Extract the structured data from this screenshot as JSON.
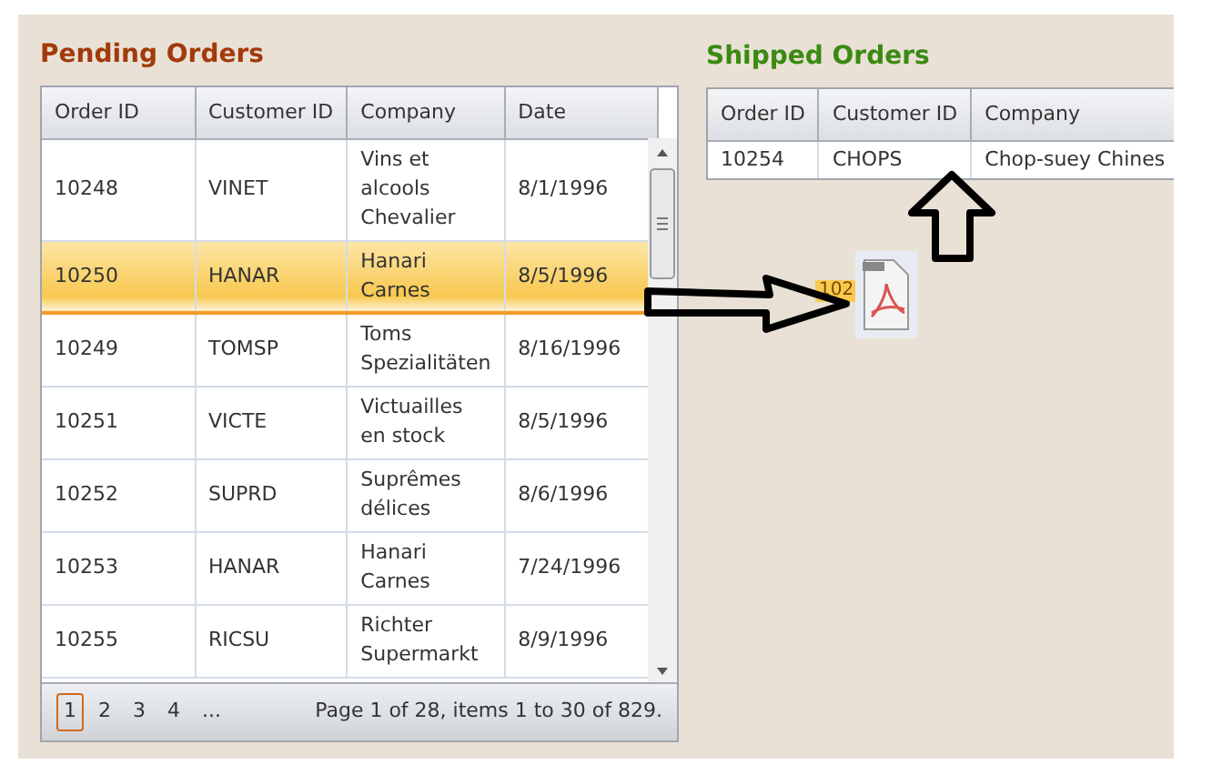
{
  "pending": {
    "title": "Pending Orders",
    "columns": [
      "Order ID",
      "Customer ID",
      "Company",
      "Date"
    ],
    "rows": [
      {
        "order_id": "10248",
        "customer_id": "VINET",
        "company": "Vins et alcools Chevalier",
        "date": "8/1/1996",
        "selected": false
      },
      {
        "order_id": "10250",
        "customer_id": "HANAR",
        "company": "Hanari Carnes",
        "date": "8/5/1996",
        "selected": true
      },
      {
        "order_id": "10249",
        "customer_id": "TOMSP",
        "company": "Toms Spezialitäten",
        "date": "8/16/1996",
        "selected": false
      },
      {
        "order_id": "10251",
        "customer_id": "VICTE",
        "company": "Victuailles en stock",
        "date": "8/5/1996",
        "selected": false
      },
      {
        "order_id": "10252",
        "customer_id": "SUPRD",
        "company": "Suprêmes délices",
        "date": "8/6/1996",
        "selected": false
      },
      {
        "order_id": "10253",
        "customer_id": "HANAR",
        "company": "Hanari Carnes",
        "date": "7/24/1996",
        "selected": false
      },
      {
        "order_id": "10255",
        "customer_id": "RICSU",
        "company": "Richter Supermarkt",
        "date": "8/9/1996",
        "selected": false
      }
    ],
    "pager": {
      "pages": [
        {
          "label": "1",
          "selected": true
        },
        {
          "label": "2",
          "selected": false
        },
        {
          "label": "3",
          "selected": false
        },
        {
          "label": "4",
          "selected": false
        },
        {
          "label": "...",
          "selected": false
        }
      ],
      "info": "Page 1 of 28, items 1 to 30 of 829."
    }
  },
  "shipped": {
    "title": "Shipped Orders",
    "columns": [
      "Order ID",
      "Customer ID",
      "Company"
    ],
    "rows": [
      {
        "order_id": "10254",
        "customer_id": "CHOPS",
        "company": "Chop-suey Chines"
      }
    ]
  },
  "drag_ghost": {
    "text": "102"
  }
}
